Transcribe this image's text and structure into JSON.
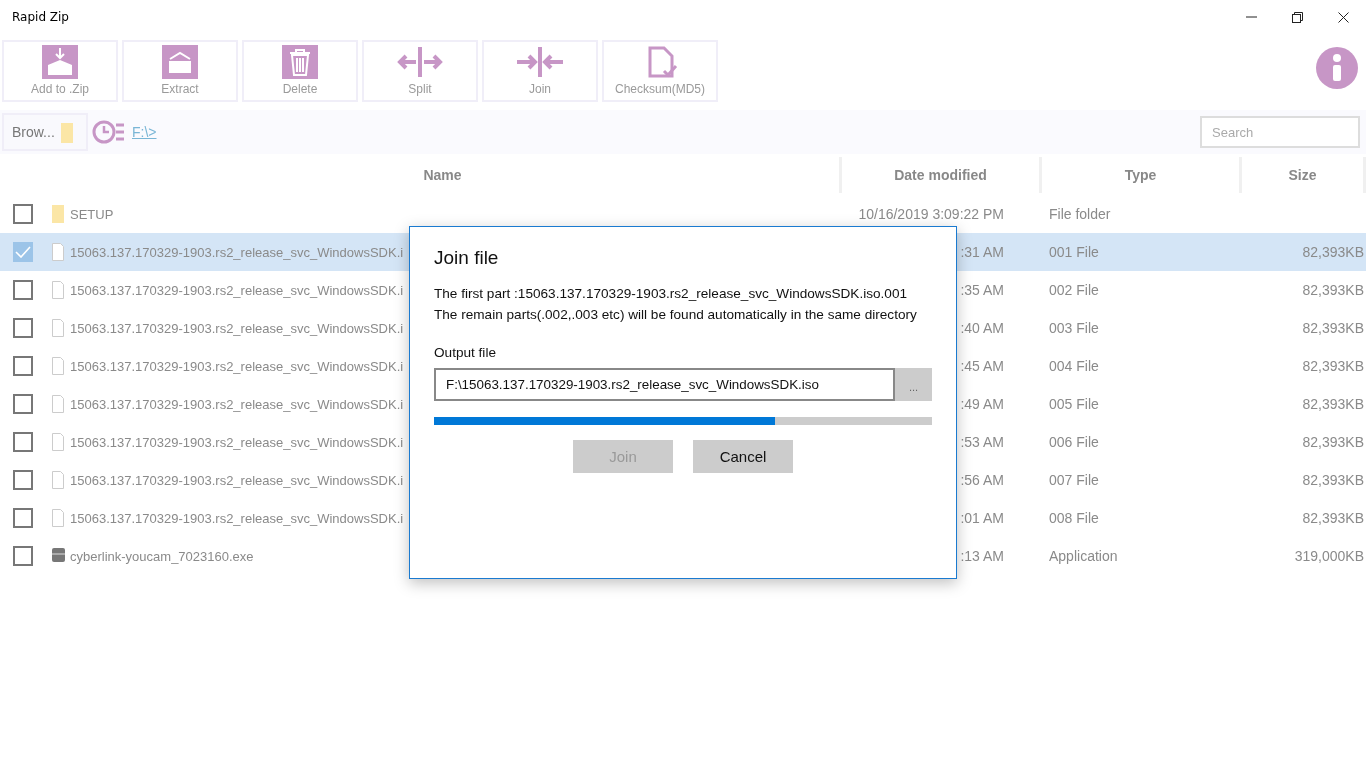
{
  "window": {
    "title": "Rapid Zip"
  },
  "toolbar": [
    {
      "label": "Add to .Zip",
      "kind": "add"
    },
    {
      "label": "Extract",
      "kind": "extract"
    },
    {
      "label": "Delete",
      "kind": "delete"
    },
    {
      "label": "Split",
      "kind": "split"
    },
    {
      "label": "Join",
      "kind": "join"
    },
    {
      "label": "Checksum(MD5)",
      "kind": "checksum"
    }
  ],
  "address_bar": {
    "browse": "Brow...",
    "path": "F:\\>"
  },
  "search": {
    "placeholder": "Search"
  },
  "table": {
    "columns": [
      "Name",
      "Date modified",
      "Type",
      "Size"
    ],
    "rows": [
      {
        "kind": "folder",
        "name": "SETUP",
        "date": "10/16/2019 3:09:22 PM",
        "type": "File folder",
        "size": "",
        "checked": false
      },
      {
        "kind": "file",
        "name": "15063.137.170329-1903.rs2_release_svc_WindowsSDK.i",
        "date": ":31 AM",
        "type": "001 File",
        "size": "82,393KB",
        "checked": true
      },
      {
        "kind": "file",
        "name": "15063.137.170329-1903.rs2_release_svc_WindowsSDK.i",
        "date": ":35 AM",
        "type": "002 File",
        "size": "82,393KB",
        "checked": false
      },
      {
        "kind": "file",
        "name": "15063.137.170329-1903.rs2_release_svc_WindowsSDK.i",
        "date": ":40 AM",
        "type": "003 File",
        "size": "82,393KB",
        "checked": false
      },
      {
        "kind": "file",
        "name": "15063.137.170329-1903.rs2_release_svc_WindowsSDK.i",
        "date": ":45 AM",
        "type": "004 File",
        "size": "82,393KB",
        "checked": false
      },
      {
        "kind": "file",
        "name": "15063.137.170329-1903.rs2_release_svc_WindowsSDK.i",
        "date": ":49 AM",
        "type": "005 File",
        "size": "82,393KB",
        "checked": false
      },
      {
        "kind": "file",
        "name": "15063.137.170329-1903.rs2_release_svc_WindowsSDK.i",
        "date": ":53 AM",
        "type": "006 File",
        "size": "82,393KB",
        "checked": false
      },
      {
        "kind": "file",
        "name": "15063.137.170329-1903.rs2_release_svc_WindowsSDK.i",
        "date": ":56 AM",
        "type": "007 File",
        "size": "82,393KB",
        "checked": false
      },
      {
        "kind": "file",
        "name": "15063.137.170329-1903.rs2_release_svc_WindowsSDK.i",
        "date": ":01 AM",
        "type": "008 File",
        "size": "82,393KB",
        "checked": false
      },
      {
        "kind": "app",
        "name": "cyberlink-youcam_7023160.exe",
        "date": ":13 AM",
        "type": "Application",
        "size": "319,000KB",
        "checked": false
      }
    ]
  },
  "dialog": {
    "title": "Join file",
    "message": [
      "The first part :15063.137.170329-1903.rs2_release_svc_WindowsSDK.iso.001",
      "The remain parts(.002,.003 etc) will be found automatically in the same directory"
    ],
    "output_label": "Output file",
    "output_value": "F:\\15063.137.170329-1903.rs2_release_svc_WindowsSDK.iso",
    "browse": "...",
    "progress": {
      "level": 0.685
    },
    "buttons": [
      {
        "label": "Join",
        "disabled": true
      },
      {
        "label": "Cancel",
        "disabled": false
      }
    ]
  }
}
